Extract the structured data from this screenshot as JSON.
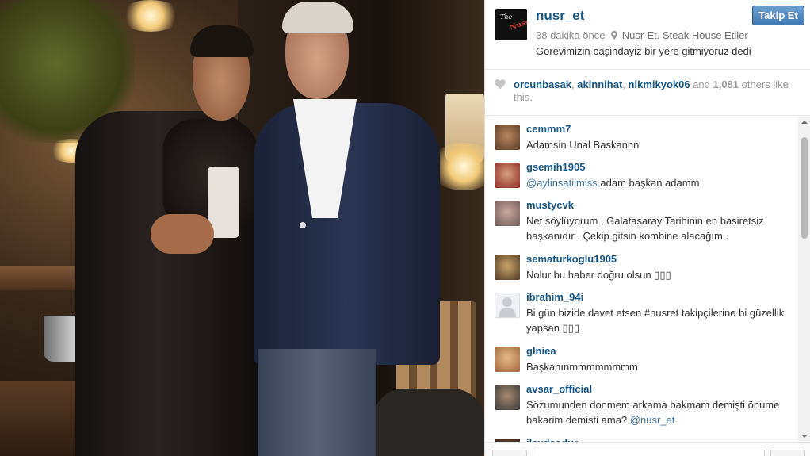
{
  "post": {
    "username": "nusr_et",
    "follow_label": "Takip Et",
    "time_ago": "38 dakika önce",
    "location": "Nusr-Et. Steak House Etiler",
    "caption": "Gorevimizin başindayiz bir yere gitmiyoruz dedi",
    "avatar_logo_top": "The",
    "avatar_logo_bottom": "Nusret"
  },
  "likes": {
    "users": [
      "orcunbasak",
      "akinnihat",
      "nikmikyok06"
    ],
    "sep1": ", ",
    "sep2": ", ",
    "and_text": " and ",
    "count": "1,081",
    "suffix": " others like this."
  },
  "comments": [
    {
      "user": "cemmm7",
      "text": "Adamsin Unal Baskannn",
      "mention": ""
    },
    {
      "user": "gsemih1905",
      "mention": "@aylinsatilmiss",
      "text": " adam başkan adamm"
    },
    {
      "user": "mustycvk",
      "text": "Net söylüyorum , Galatasaray Tarihinin en basiretsiz başkanıdır . Çekip gitsin kombine alacağım .",
      "mention": ""
    },
    {
      "user": "sematurkoglu1905",
      "text": "Nolur bu haber doğru olsun ▯▯▯",
      "mention": ""
    },
    {
      "user": "ibrahim_94i",
      "text": "Bi gün bizide davet etsen #nusret takipçilerine bi güzellik yapsan ▯▯▯",
      "mention": ""
    },
    {
      "user": "glniea",
      "text": "Başkanınmmmmmmmm",
      "mention": ""
    },
    {
      "user": "avsar_official",
      "text": "Sözumunden donmem arkama bakmam demişti önume bakarim demisti ama? ",
      "mention": "@nusr_et"
    },
    {
      "user": "ilaydaadur",
      "text": "",
      "mention": ""
    }
  ],
  "colors": {
    "link": "#125688",
    "follow_button": "#3f79b3",
    "muted": "#8a8a8a"
  }
}
